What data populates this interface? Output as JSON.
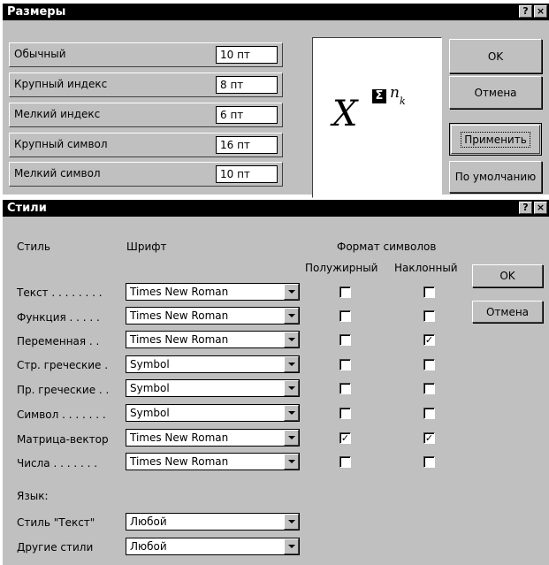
{
  "sizes_dialog": {
    "title": "Размеры",
    "help_glyph": "?",
    "close_glyph": "×",
    "rows": [
      {
        "label": "Обычный",
        "value": "10 пт"
      },
      {
        "label": "Крупный индекс",
        "value": "8 пт"
      },
      {
        "label": "Мелкий индекс",
        "value": "6 пт"
      },
      {
        "label": "Крупный символ",
        "value": "16 пт"
      },
      {
        "label": "Мелкий символ",
        "value": "10 пт"
      }
    ],
    "preview": {
      "base": "X",
      "symbol": "Σ",
      "exponent": "n",
      "subscript": "k"
    },
    "buttons": {
      "ok": "OK",
      "cancel": "Отмена",
      "apply": "Применить",
      "default": "По умолчанию"
    }
  },
  "styles_dialog": {
    "title": "Стили",
    "help_glyph": "?",
    "close_glyph": "×",
    "headers": {
      "style": "Стиль",
      "font": "Шрифт",
      "format": "Формат символов",
      "bold": "Полужирный",
      "italic": "Наклонный"
    },
    "rows": [
      {
        "label": "Текст . . . . . . . .",
        "font": "Times New Roman",
        "bold": false,
        "italic": false
      },
      {
        "label": "Функция . . . . .",
        "font": "Times New Roman",
        "bold": false,
        "italic": false
      },
      {
        "label": "Переменная . .",
        "font": "Times New Roman",
        "bold": false,
        "italic": true
      },
      {
        "label": "Стр. греческие .",
        "font": "Symbol",
        "bold": false,
        "italic": false
      },
      {
        "label": "Пр. греческие . .",
        "font": "Symbol",
        "bold": false,
        "italic": false
      },
      {
        "label": "Символ . . . . . . .",
        "font": "Symbol",
        "bold": false,
        "italic": false
      },
      {
        "label": "Матрица-вектор",
        "font": "Times New Roman",
        "bold": true,
        "italic": true
      },
      {
        "label": "Числа . . . . . . .",
        "font": "Times New Roman",
        "bold": false,
        "italic": false
      }
    ],
    "language": {
      "label": "Язык:",
      "text_style_label": "Стиль \"Текст\"",
      "text_style_value": "Любой",
      "other_styles_label": "Другие стили",
      "other_styles_value": "Любой"
    },
    "buttons": {
      "ok": "OK",
      "cancel": "Отмена"
    },
    "check_glyph": "✓"
  }
}
